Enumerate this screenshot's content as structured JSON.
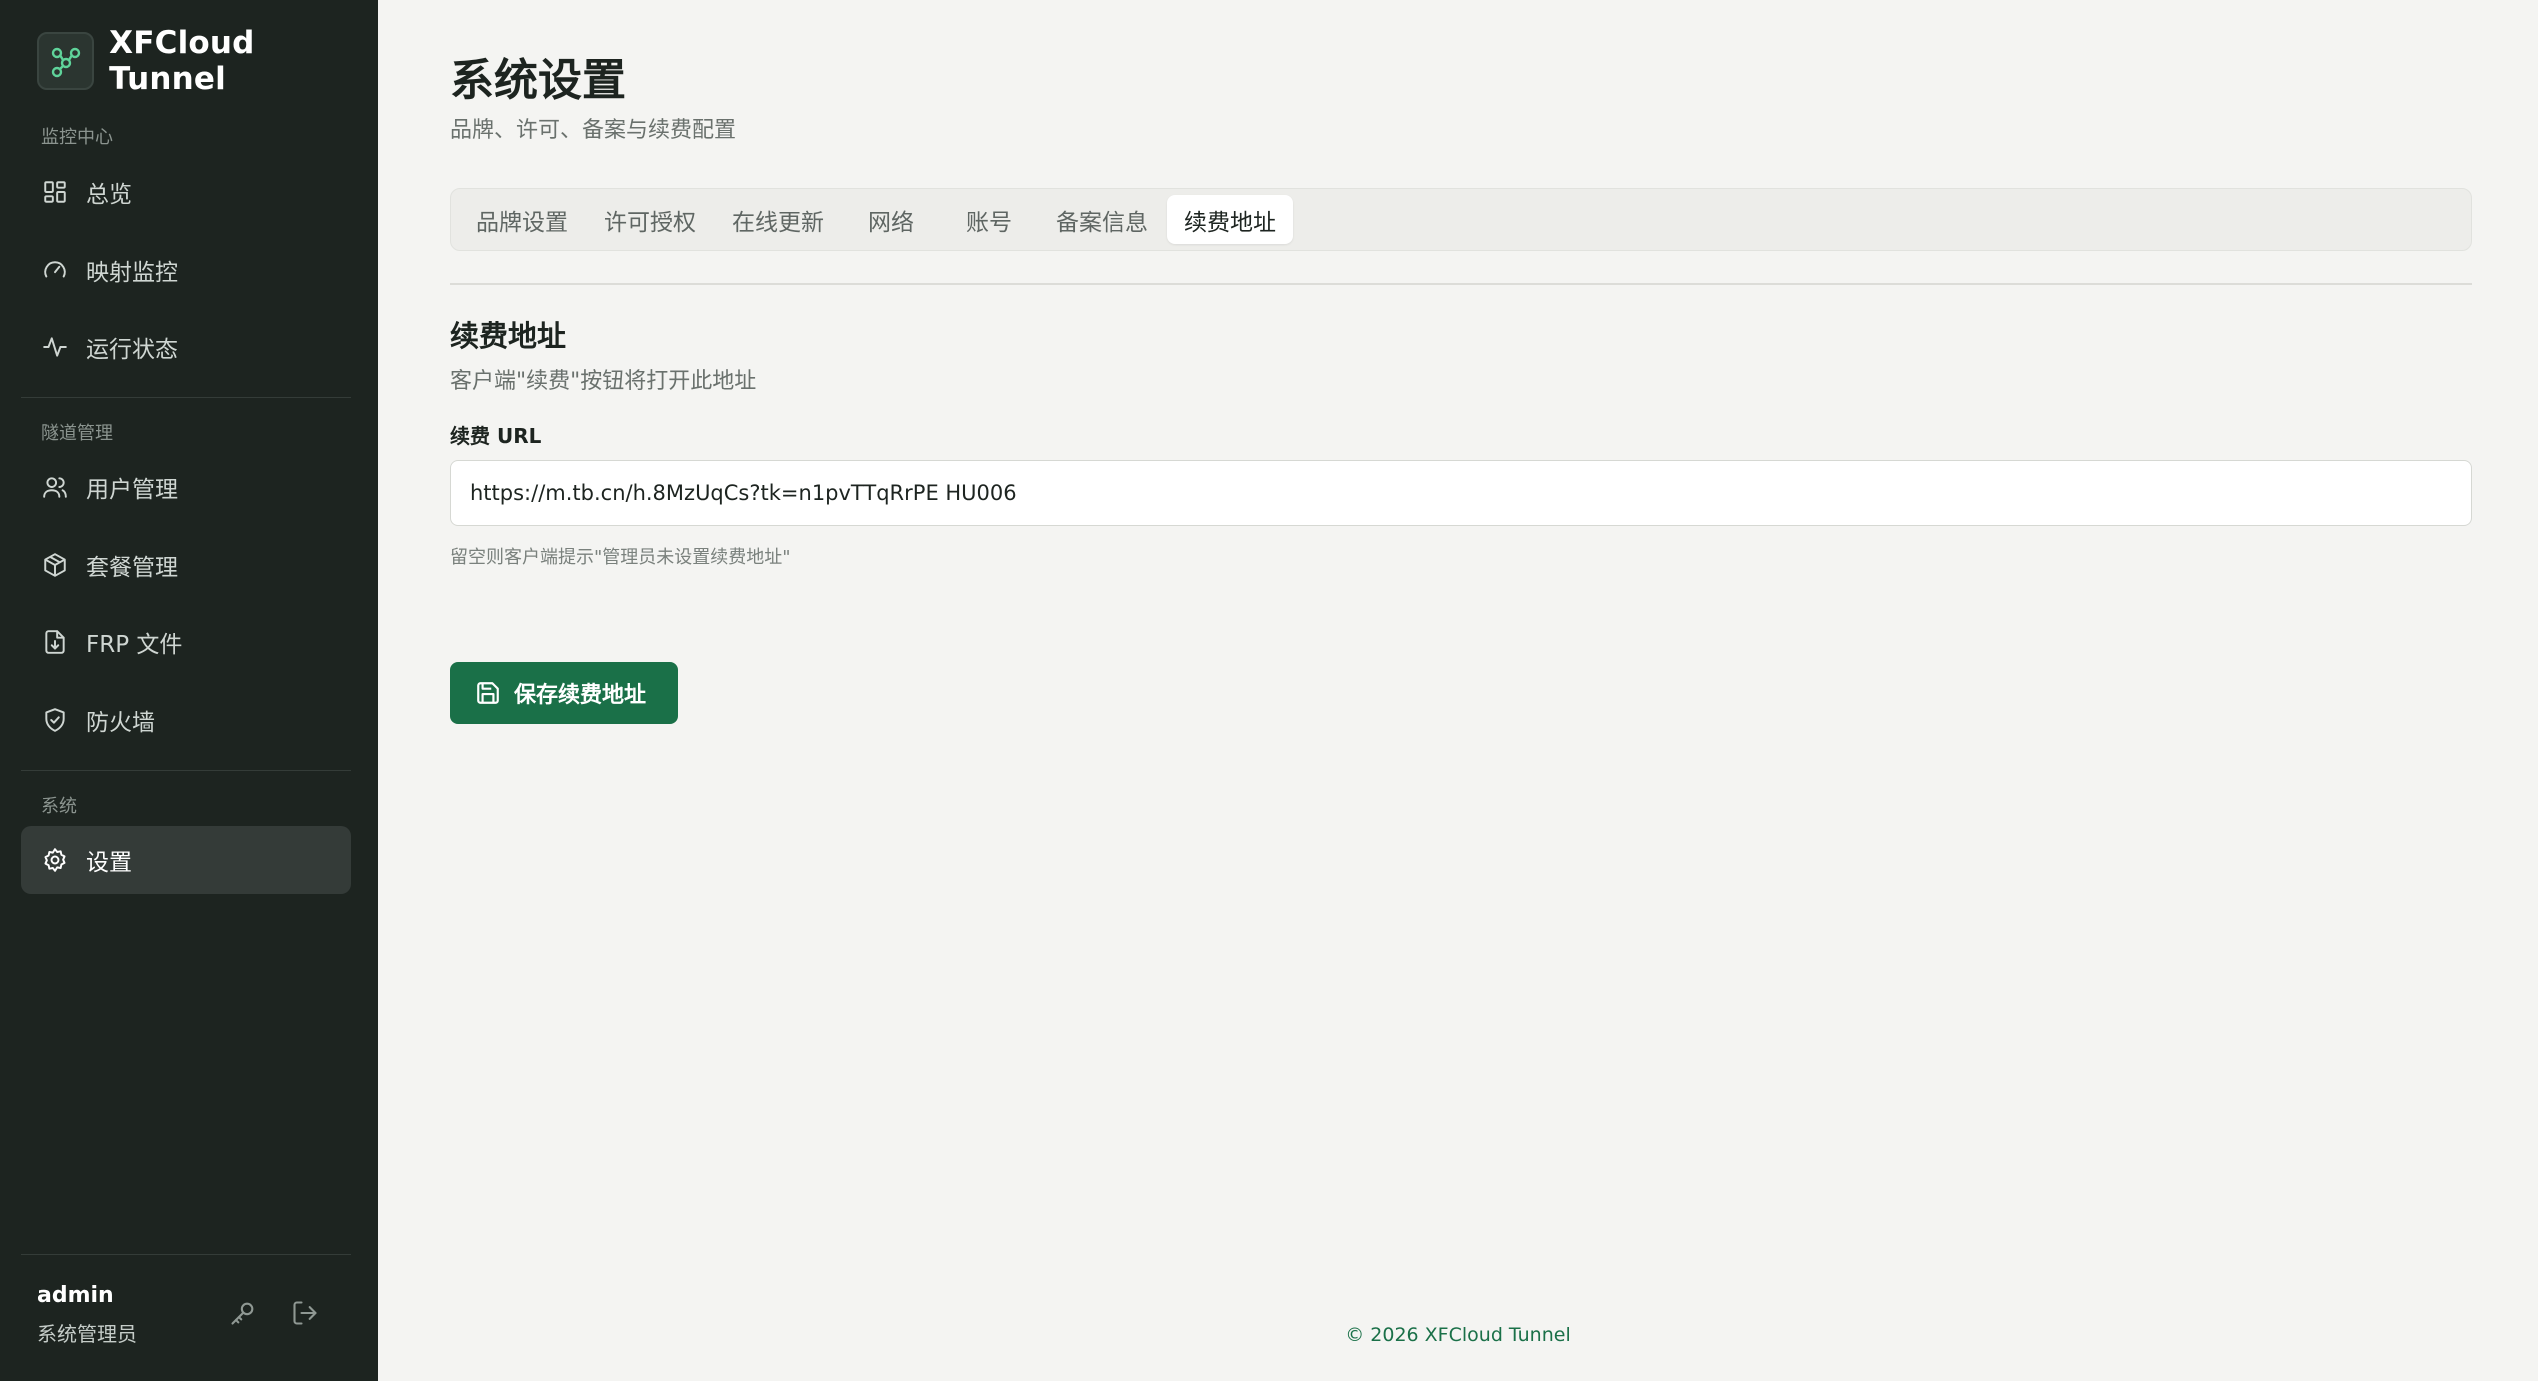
{
  "app": {
    "name": "XFCloud Tunnel",
    "accent_color": "#1a7048",
    "sidebar_bg": "#1d2420"
  },
  "sidebar": {
    "sections": [
      {
        "title": "监控中心",
        "items": [
          {
            "label": "总览",
            "icon": "dashboard-icon"
          },
          {
            "label": "映射监控",
            "icon": "gauge-icon"
          },
          {
            "label": "运行状态",
            "icon": "activity-icon"
          }
        ]
      },
      {
        "title": "隧道管理",
        "items": [
          {
            "label": "用户管理",
            "icon": "users-icon"
          },
          {
            "label": "套餐管理",
            "icon": "package-icon"
          },
          {
            "label": "FRP 文件",
            "icon": "file-download-icon"
          },
          {
            "label": "防火墙",
            "icon": "shield-check-icon"
          }
        ]
      },
      {
        "title": "系统",
        "items": [
          {
            "label": "设置",
            "icon": "settings-icon",
            "active": true
          }
        ]
      }
    ],
    "user": {
      "name": "admin",
      "role": "系统管理员"
    }
  },
  "page": {
    "title": "系统设置",
    "subtitle": "品牌、许可、备案与续费配置",
    "tabs": [
      {
        "label": "品牌设置"
      },
      {
        "label": "许可授权"
      },
      {
        "label": "在线更新"
      },
      {
        "label": "网络"
      },
      {
        "label": "账号"
      },
      {
        "label": "备案信息"
      },
      {
        "label": "续费地址",
        "active": true
      }
    ]
  },
  "renewal": {
    "section_title": "续费地址",
    "section_desc": "客户端\"续费\"按钮将打开此地址",
    "field_label": "续费 URL",
    "url_value": "https://m.tb.cn/h.8MzUqCs?tk=n1pvTTqRrPE HU006",
    "hint": "留空则客户端提示\"管理员未设置续费地址\"",
    "save_label": "保存续费地址"
  },
  "footer": {
    "text": "© 2026 XFCloud Tunnel"
  }
}
